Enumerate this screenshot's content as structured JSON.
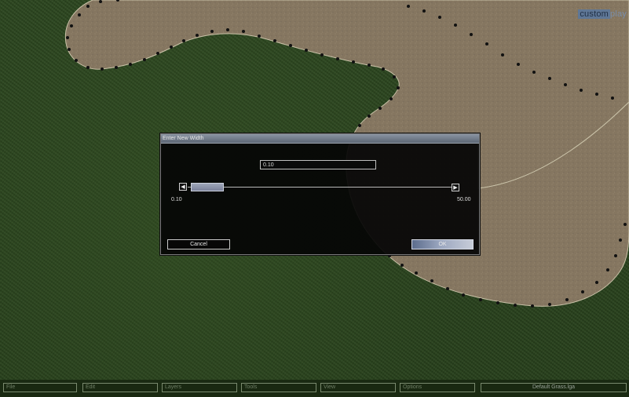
{
  "logo": {
    "part1": "custom",
    "part2": "play"
  },
  "dialog": {
    "title": "Enter New Width",
    "value": "0.10",
    "left_arrow": "◀",
    "right_arrow": "▶",
    "min_label": "0.10",
    "max_label": "50.00",
    "slider_value": 0.1,
    "cancel_label": "Cancel",
    "ok_label": "OK"
  },
  "menubar": {
    "items": [
      "File",
      "Edit",
      "Layers",
      "Tools",
      "View",
      "Options",
      "Default Grass.lga"
    ]
  },
  "colors": {
    "grass": "#2c4620",
    "sand": "#857660",
    "dialog_bg": "#050505",
    "ok_button": "#9aa6bf"
  }
}
